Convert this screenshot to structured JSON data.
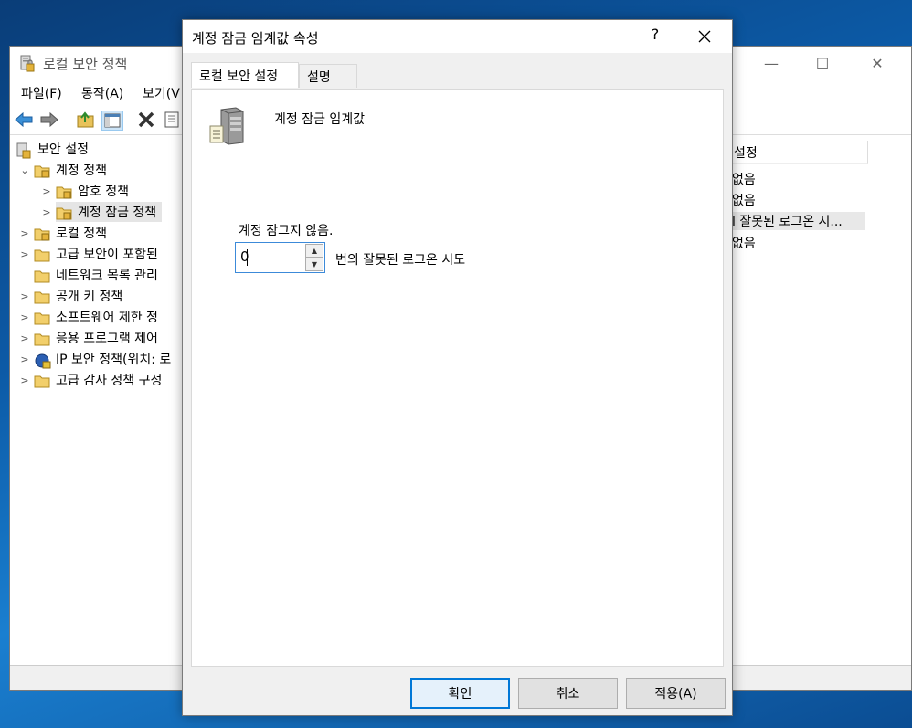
{
  "main_window": {
    "title": "로컬 보안 정책",
    "menu": [
      "파일(F)",
      "동작(A)",
      "보기(V"
    ],
    "tree": [
      {
        "label": "보안 설정",
        "level": 0,
        "chevron": ""
      },
      {
        "label": "계정 정책",
        "level": 1,
        "chevron": "⌄"
      },
      {
        "label": "암호 정책",
        "level": 2,
        "chevron": ">"
      },
      {
        "label": "계정 잠금 정책",
        "level": 2,
        "chevron": ">"
      },
      {
        "label": "로컬 정책",
        "level": 1,
        "chevron": ">"
      },
      {
        "label": "고급 보안이 포함된",
        "level": 1,
        "chevron": ">"
      },
      {
        "label": "네트워크 목록 관리",
        "level": 1,
        "chevron": ""
      },
      {
        "label": "공개 키 정책",
        "level": 1,
        "chevron": ">"
      },
      {
        "label": "소프트웨어 제한 정",
        "level": 1,
        "chevron": ">"
      },
      {
        "label": "응용 프로그램 제어",
        "level": 1,
        "chevron": ">"
      },
      {
        "label": "IP 보안 정책(위치: 로",
        "level": 1,
        "chevron": ">"
      },
      {
        "label": "고급 감사 정책 구성",
        "level": 1,
        "chevron": ">"
      }
    ],
    "right_column_header": "설정",
    "right_items": [
      "없음",
      "없음",
      "l 잘못된 로그온 시...",
      "없음"
    ]
  },
  "dialog": {
    "title": "계정 잠금 임계값 속성",
    "help": "?",
    "tabs": [
      "로컬 보안 설정",
      "설명"
    ],
    "policy_name": "계정 잠금 임계값",
    "status_label": "계정 잠그지 않음.",
    "threshold_value": "0",
    "threshold_suffix": "번의 잘못된 로그온 시도",
    "buttons": {
      "ok": "확인",
      "cancel": "취소",
      "apply": "적용(A)"
    }
  }
}
